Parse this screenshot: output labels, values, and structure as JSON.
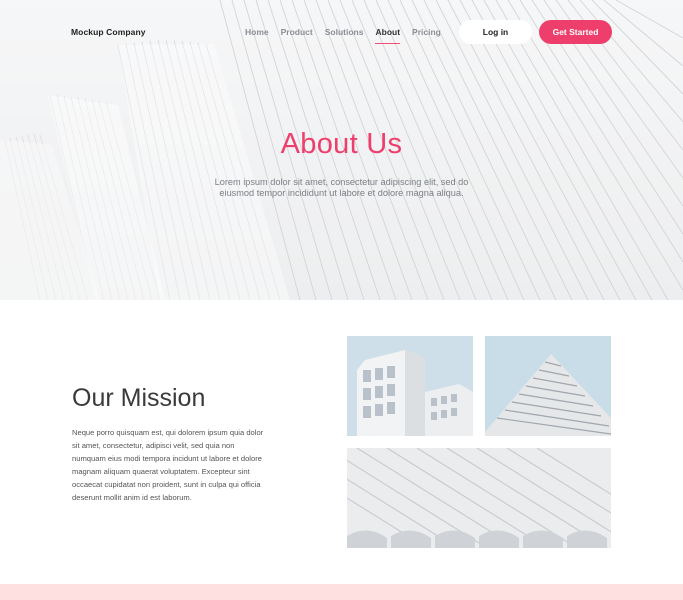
{
  "nav": {
    "brand": "Mockup Company",
    "links": [
      {
        "label": "Home",
        "active": false
      },
      {
        "label": "Product",
        "active": false
      },
      {
        "label": "Solutions",
        "active": false
      },
      {
        "label": "About",
        "active": true
      },
      {
        "label": "Pricing",
        "active": false
      }
    ],
    "login_label": "Log in",
    "cta_label": "Get Started"
  },
  "hero": {
    "title": "About Us",
    "subtitle": "Lorem ipsum dolor sit amet, consectetur adipiscing elit, sed do eiusmod tempor incididunt ut labore et dolore magna aliqua."
  },
  "mission": {
    "title": "Our Mission",
    "body": "Neque porro quisquam est, qui dolorem ipsum quia dolor sit amet, consectetur, adipisci velit, sed quia non numquam eius modi tempora incidunt ut labore et dolore magnam aliquam quaerat voluptatem. Excepteur sint occaecat cupidatat non proident, sunt in culpa qui officia deserunt mollit anim id est laborum."
  },
  "colors": {
    "accent": "#ee3f6c",
    "footer_band": "#ffe0e0"
  }
}
